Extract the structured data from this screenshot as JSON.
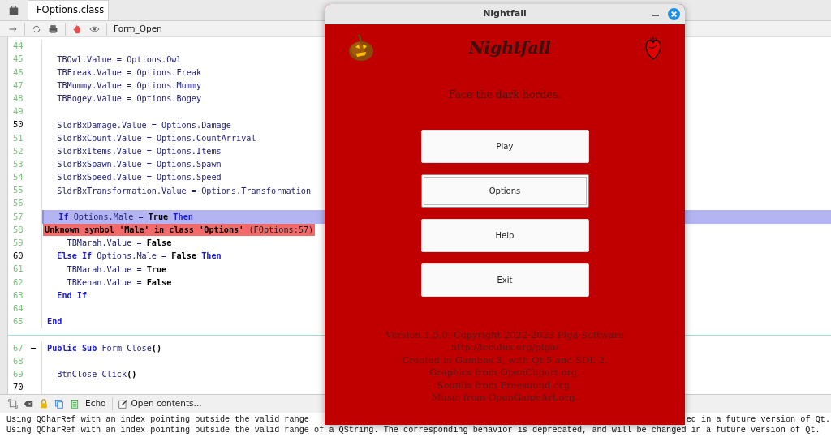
{
  "editor": {
    "tabs": [
      {
        "label": "FOptions.class",
        "selected": true
      }
    ],
    "toolbar": {
      "procedure": "Form_Open"
    },
    "lines": [
      {
        "kind": "code",
        "number": "44",
        "current": false,
        "selected": false
      },
      {
        "kind": "code",
        "number": "45",
        "current": false,
        "selected": false,
        "tokens": [
          {
            "text": "  TBOwl.Value = Options.Owl",
            "kind": "plain"
          }
        ]
      },
      {
        "kind": "code",
        "number": "46",
        "current": false,
        "selected": false,
        "tokens": [
          {
            "text": "  TBFreak.Value = Options.Freak",
            "kind": "plain"
          }
        ]
      },
      {
        "kind": "code",
        "number": "47",
        "current": false,
        "selected": false,
        "tokens": [
          {
            "text": "  TBMummy.Value = Options.Mummy",
            "kind": "plain"
          }
        ]
      },
      {
        "kind": "code",
        "number": "48",
        "current": false,
        "selected": false,
        "tokens": [
          {
            "text": "  TBBogey.Value = Options.Bogey",
            "kind": "plain"
          }
        ]
      },
      {
        "kind": "code",
        "number": "49",
        "current": false,
        "selected": false
      },
      {
        "kind": "code",
        "number": "50",
        "current": true,
        "selected": false,
        "tokens": [
          {
            "text": "  SldrBxDamage.Value = Options.Damage",
            "kind": "plain"
          }
        ]
      },
      {
        "kind": "code",
        "number": "51",
        "current": false,
        "selected": false,
        "tokens": [
          {
            "text": "  SldrBxCount.Value = Options.CountArrival",
            "kind": "plain"
          }
        ]
      },
      {
        "kind": "code",
        "number": "52",
        "current": false,
        "selected": false,
        "tokens": [
          {
            "text": "  SldrBxItems.Value = Options.Items",
            "kind": "plain"
          }
        ]
      },
      {
        "kind": "code",
        "number": "53",
        "current": false,
        "selected": false,
        "tokens": [
          {
            "text": "  SldrBxSpawn.Value = Options.Spawn",
            "kind": "plain"
          }
        ]
      },
      {
        "kind": "code",
        "number": "54",
        "current": false,
        "selected": false,
        "tokens": [
          {
            "text": "  SldrBxSpeed.Value = Options.Speed",
            "kind": "plain"
          }
        ]
      },
      {
        "kind": "code",
        "number": "55",
        "current": false,
        "selected": false,
        "tokens": [
          {
            "text": "  SldrBxTransformation.Value = Options.Transformation",
            "kind": "plain"
          }
        ]
      },
      {
        "kind": "code",
        "number": "56",
        "current": false,
        "selected": false
      },
      {
        "kind": "code",
        "number": "57",
        "current": false,
        "selected": true,
        "tokens": [
          {
            "text": "  If",
            "kind": "keyword"
          },
          {
            "text": " Options.Male = ",
            "kind": "plain"
          },
          {
            "text": "True",
            "kind": "literal"
          },
          {
            "text": " Then",
            "kind": "keyword"
          }
        ]
      },
      {
        "kind": "error",
        "number": "58",
        "message": "Unknown symbol 'Male' in class 'Options'",
        "location": "(FOptions:57)"
      },
      {
        "kind": "code",
        "number": "59",
        "current": false,
        "selected": false,
        "tokens": [
          {
            "text": "    TBMarah.Value = ",
            "kind": "plain"
          },
          {
            "text": "False",
            "kind": "literal"
          }
        ]
      },
      {
        "kind": "code",
        "number": "60",
        "current": true,
        "selected": false,
        "tokens": [
          {
            "text": "  Else If",
            "kind": "keyword"
          },
          {
            "text": " Options.Male = ",
            "kind": "plain"
          },
          {
            "text": "False",
            "kind": "literal"
          },
          {
            "text": " Then",
            "kind": "keyword"
          }
        ]
      },
      {
        "kind": "code",
        "number": "61",
        "current": false,
        "selected": false,
        "tokens": [
          {
            "text": "    TBMarah.Value = ",
            "kind": "plain"
          },
          {
            "text": "True",
            "kind": "literal"
          }
        ]
      },
      {
        "kind": "code",
        "number": "62",
        "current": false,
        "selected": false,
        "tokens": [
          {
            "text": "    TBKenan.Value = ",
            "kind": "plain"
          },
          {
            "text": "False",
            "kind": "literal"
          }
        ]
      },
      {
        "kind": "code",
        "number": "63",
        "current": false,
        "selected": false,
        "tokens": [
          {
            "text": "  End If",
            "kind": "keyword"
          }
        ]
      },
      {
        "kind": "code",
        "number": "64",
        "current": false,
        "selected": false
      },
      {
        "kind": "code",
        "number": "65",
        "current": false,
        "selected": false,
        "tokens": [
          {
            "text": "End",
            "kind": "keyword"
          }
        ]
      },
      {
        "kind": "divider"
      },
      {
        "kind": "code",
        "number": "67",
        "current": false,
        "selected": false,
        "fold": "—",
        "tokens": [
          {
            "text": "Public Sub",
            "kind": "keyword"
          },
          {
            "text": " Form_Close",
            "kind": "plain"
          },
          {
            "text": "()",
            "kind": "literal"
          }
        ]
      },
      {
        "kind": "code",
        "number": "68",
        "current": false,
        "selected": false
      },
      {
        "kind": "code",
        "number": "69",
        "current": false,
        "selected": false,
        "tokens": [
          {
            "text": "  BtnClose_Click",
            "kind": "plain"
          },
          {
            "text": "()",
            "kind": "literal"
          }
        ]
      },
      {
        "kind": "code",
        "number": "70",
        "current": true,
        "selected": false
      }
    ]
  },
  "console": {
    "toolbar": {
      "echo": "Echo",
      "open": "Open contents..."
    },
    "lines": [
      {
        "left": "Using QCharRef with an index pointing outside the valid range",
        "right": "ed in a future version of Qt."
      },
      {
        "left": "Using QCharRef with an index pointing outside the valid range of a QString. The corresponding behavior is deprecated, and will be changed in a future version of Qt."
      }
    ]
  },
  "game_window": {
    "title": "Nightfall",
    "heading": "Nightfall",
    "tagline": "Face the dark hordes.",
    "buttons": [
      {
        "label": "Play",
        "focused": false
      },
      {
        "label": "Options",
        "focused": true
      },
      {
        "label": "Help",
        "focused": false
      },
      {
        "label": "Exit",
        "focused": false
      }
    ],
    "credits": [
      "Version 1.5.0. Copyright 2022-2023 Piga Software",
      "http://icculus.org/piga/",
      "Created in Gambas 3, with Qt 5 and SDL 2.",
      "Graphics from OpenClipart.org.",
      "Sounds from Freesound.org.",
      "Music from OpenGameArt.org."
    ]
  }
}
